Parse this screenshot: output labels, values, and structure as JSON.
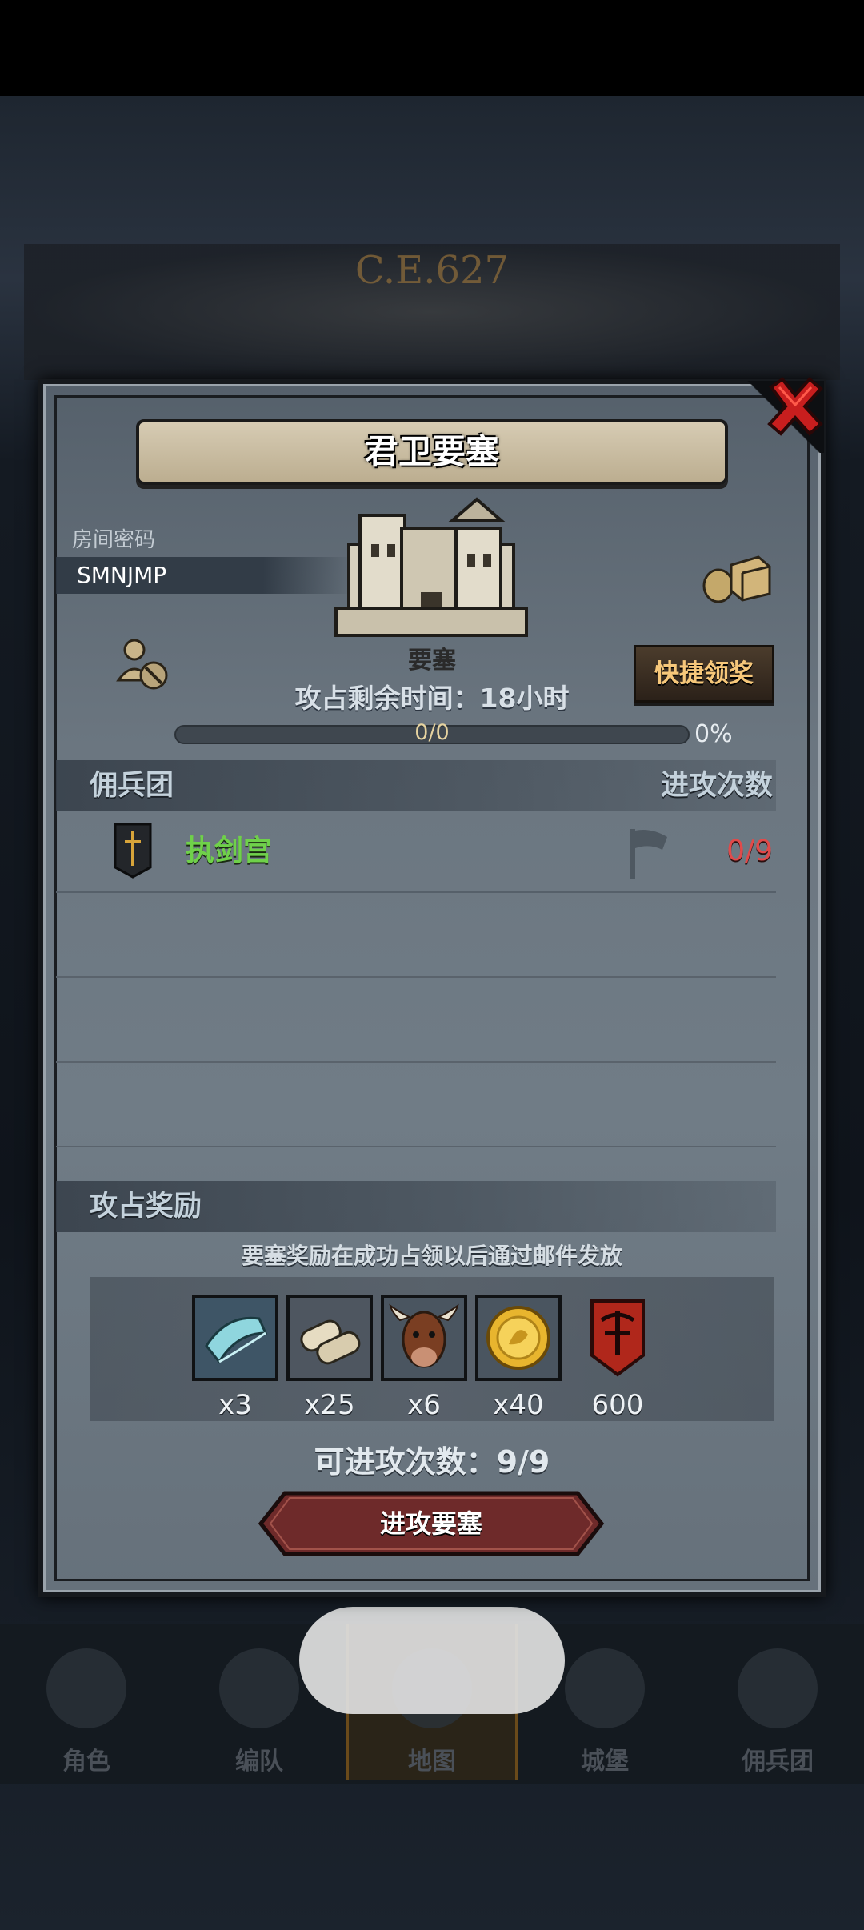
{
  "background": {
    "year_banner": "C.E.627"
  },
  "modal": {
    "title": "君卫要塞",
    "room_label": "房间密码",
    "room_code": "SMNJMP",
    "fortress_label": "要塞",
    "quick_claim_label": "快捷领奖",
    "remaining_time": "攻占剩余时间：18小时",
    "progress": {
      "text": "0/0",
      "percent_text": "0%",
      "value": 0
    },
    "mercenary_section": {
      "title": "佣兵团",
      "right_title": "进攻次数"
    },
    "mercenaries": [
      {
        "name": "执剑宫",
        "attacks": "0/9"
      }
    ],
    "reward_section": {
      "title": "攻占奖励"
    },
    "reward_note": "要塞奖励在成功占领以后通过邮件发放",
    "rewards": [
      {
        "icon": "cloth-icon",
        "count": "x3"
      },
      {
        "icon": "scroll-icon",
        "count": "x25"
      },
      {
        "icon": "cattle-icon",
        "count": "x6"
      },
      {
        "icon": "gold-coin-icon",
        "count": "x40"
      },
      {
        "icon": "red-banner-icon",
        "count": "600"
      }
    ],
    "attacks_available": "可进攻次数：9/9",
    "attack_button_label": "进攻要塞"
  },
  "bottom_nav": {
    "items": [
      {
        "label": "角色"
      },
      {
        "label": "编队"
      },
      {
        "label": "地图",
        "active": true
      },
      {
        "label": "城堡"
      },
      {
        "label": "佣兵团"
      }
    ]
  },
  "colors": {
    "accent_gold": "#f6c77a",
    "merc_name_green": "#6fd14a",
    "attack_count_red": "#e14a4a",
    "attack_button": "#6e2a2a"
  }
}
